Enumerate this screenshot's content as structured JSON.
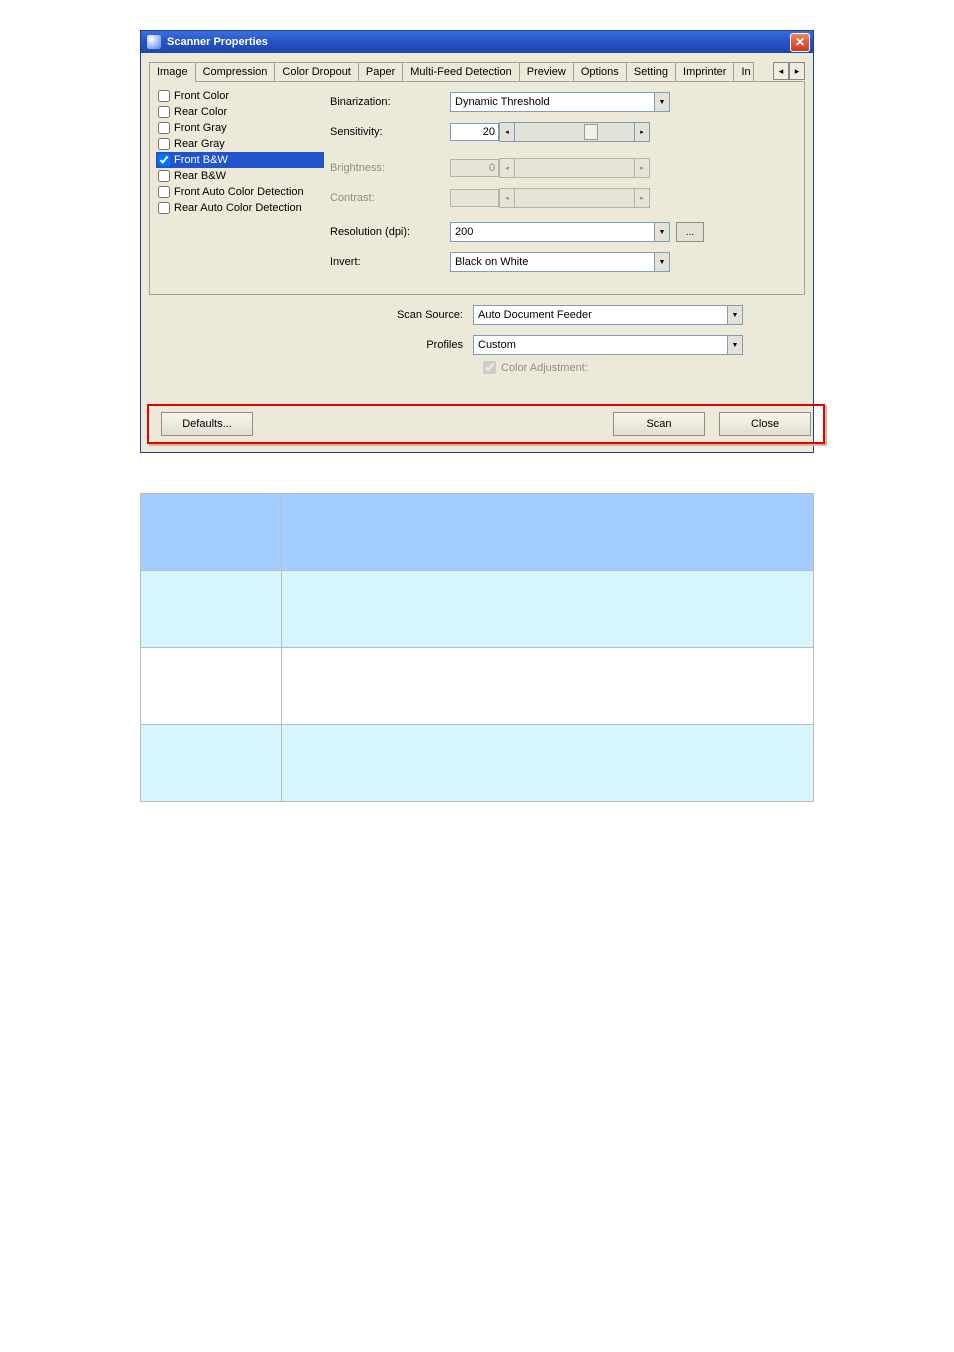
{
  "window": {
    "title": "Scanner Properties"
  },
  "tabs": [
    "Image",
    "Compression",
    "Color Dropout",
    "Paper",
    "Multi-Feed Detection",
    "Preview",
    "Options",
    "Setting",
    "Imprinter",
    "In"
  ],
  "sideList": [
    {
      "label": "Front Color",
      "checked": false,
      "selected": false
    },
    {
      "label": "Rear Color",
      "checked": false,
      "selected": false
    },
    {
      "label": "Front Gray",
      "checked": false,
      "selected": false
    },
    {
      "label": "Rear Gray",
      "checked": false,
      "selected": false
    },
    {
      "label": "Front B&W",
      "checked": true,
      "selected": true
    },
    {
      "label": "Rear B&W",
      "checked": false,
      "selected": false
    },
    {
      "label": "Front Auto Color Detection",
      "checked": false,
      "selected": false
    },
    {
      "label": "Rear Auto Color Detection",
      "checked": false,
      "selected": false
    }
  ],
  "panel": {
    "binarizationLabel": "Binarization:",
    "binarizationValue": "Dynamic Threshold",
    "sensitivityLabel": "Sensitivity:",
    "sensitivityValue": "20",
    "brightnessLabel": "Brightness:",
    "brightnessValue": "0",
    "contrastLabel": "Contrast:",
    "resolutionLabel": "Resolution (dpi):",
    "resolutionValue": "200",
    "moreGlyph": "...",
    "invertLabel": "Invert:",
    "invertValue": "Black on White"
  },
  "mid": {
    "scanSourceLabel": "Scan Source:",
    "scanSourceValue": "Auto Document Feeder",
    "profilesLabel": "Profiles",
    "profilesValue": "Custom",
    "colorAdjLabel": "Color Adjustment:"
  },
  "buttons": {
    "defaults": "Defaults...",
    "scan": "Scan",
    "close": "Close"
  },
  "descTable": {
    "header": [
      "",
      ""
    ],
    "rows": [
      [
        "",
        ""
      ],
      [
        "",
        ""
      ],
      [
        "",
        ""
      ]
    ]
  }
}
